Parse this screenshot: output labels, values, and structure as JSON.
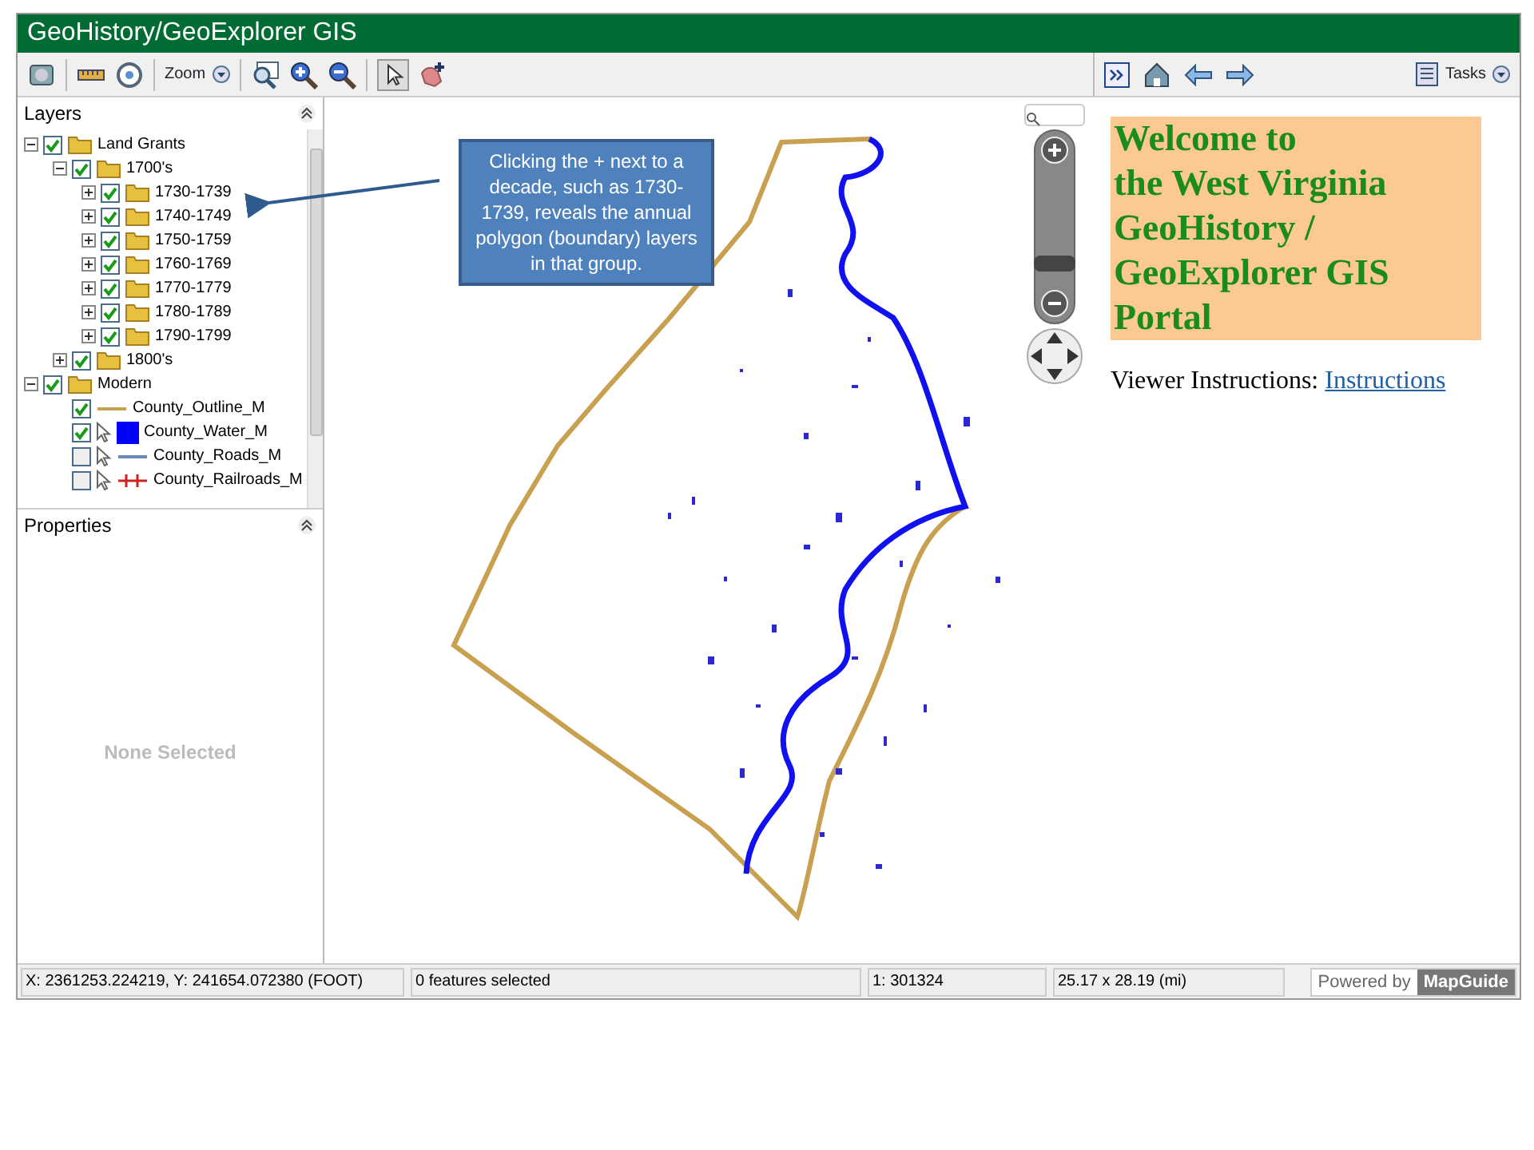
{
  "window": {
    "title": "GeoHistory/GeoExplorer GIS"
  },
  "toolbar": {
    "zoom_label": "Zoom"
  },
  "layers_panel": {
    "title": "Layers",
    "tree": [
      {
        "label": "Land Grants",
        "kind": "folder",
        "expanded": true,
        "checked": true,
        "children": [
          {
            "label": "1700's",
            "kind": "folder",
            "expanded": true,
            "checked": true,
            "children": [
              {
                "label": "1730-1739",
                "kind": "folder",
                "expanded": false,
                "checked": true
              },
              {
                "label": "1740-1749",
                "kind": "folder",
                "expanded": false,
                "checked": true
              },
              {
                "label": "1750-1759",
                "kind": "folder",
                "expanded": false,
                "checked": true
              },
              {
                "label": "1760-1769",
                "kind": "folder",
                "expanded": false,
                "checked": true
              },
              {
                "label": "1770-1779",
                "kind": "folder",
                "expanded": false,
                "checked": true
              },
              {
                "label": "1780-1789",
                "kind": "folder",
                "expanded": false,
                "checked": true
              },
              {
                "label": "1790-1799",
                "kind": "folder",
                "expanded": false,
                "checked": true
              }
            ]
          },
          {
            "label": "1800's",
            "kind": "folder",
            "expanded": false,
            "checked": true
          }
        ]
      },
      {
        "label": "Modern",
        "kind": "folder",
        "expanded": true,
        "checked": true,
        "children": [
          {
            "label": "County_Outline_M",
            "kind": "line",
            "checked": true,
            "color": "#c8a050"
          },
          {
            "label": "County_Water_M",
            "kind": "fill",
            "checked": true,
            "selectable": true,
            "color": "#0000ff"
          },
          {
            "label": "County_Roads_M",
            "kind": "line",
            "checked": false,
            "selectable": true,
            "color": "#6a8ab8"
          },
          {
            "label": "County_Railroads_M",
            "kind": "rail",
            "checked": false,
            "selectable": true,
            "color": "#d02020"
          }
        ]
      }
    ]
  },
  "properties_panel": {
    "title": "Properties",
    "empty_text": "None Selected"
  },
  "map": {
    "callout": "Clicking the + next to a decade, such as 1730-1739, reveals the annual polygon (boundary) layers in that group.",
    "zoom_slider": {
      "level": 0.3
    }
  },
  "task_pane": {
    "tasks_label": "Tasks",
    "welcome_lines": [
      "Welcome to",
      "the West Virginia",
      "GeoHistory /",
      "GeoExplorer GIS",
      "Portal"
    ],
    "instructions_label": "Viewer Instructions:",
    "instructions_link": "Instructions"
  },
  "status_bar": {
    "coordinates": "X: 2361253.224219, Y: 241654.072380 (FOOT)",
    "selection": "0 features selected",
    "scale": "1: 301324",
    "extent": "25.17 x 28.19 (mi)",
    "powered_by": "Powered by",
    "brand": "MapGuide"
  }
}
